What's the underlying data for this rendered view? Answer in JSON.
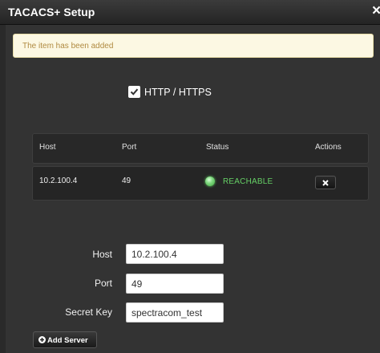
{
  "window": {
    "title": "TACACS+ Setup",
    "close_glyph": "×",
    "close_icon": "close-icon"
  },
  "alert": {
    "message": "The item has been added"
  },
  "protocol": {
    "label": "HTTP / HTTPS",
    "checked": true
  },
  "servers_table": {
    "columns": [
      "Host",
      "Port",
      "Status",
      "Actions"
    ],
    "rows": [
      {
        "host": "10.2.100.4",
        "port": "49",
        "status": "REACHABLE",
        "status_color": "#66d066",
        "action_icon": "delete-icon"
      }
    ]
  },
  "form": {
    "host": {
      "label": "Host",
      "value": "10.2.100.4"
    },
    "port": {
      "label": "Port",
      "value": "49"
    },
    "secret": {
      "label": "Secret Key",
      "value": "spectracom_test"
    }
  },
  "add_button": {
    "label": "Add Server",
    "icon": "plus-circle-icon"
  }
}
